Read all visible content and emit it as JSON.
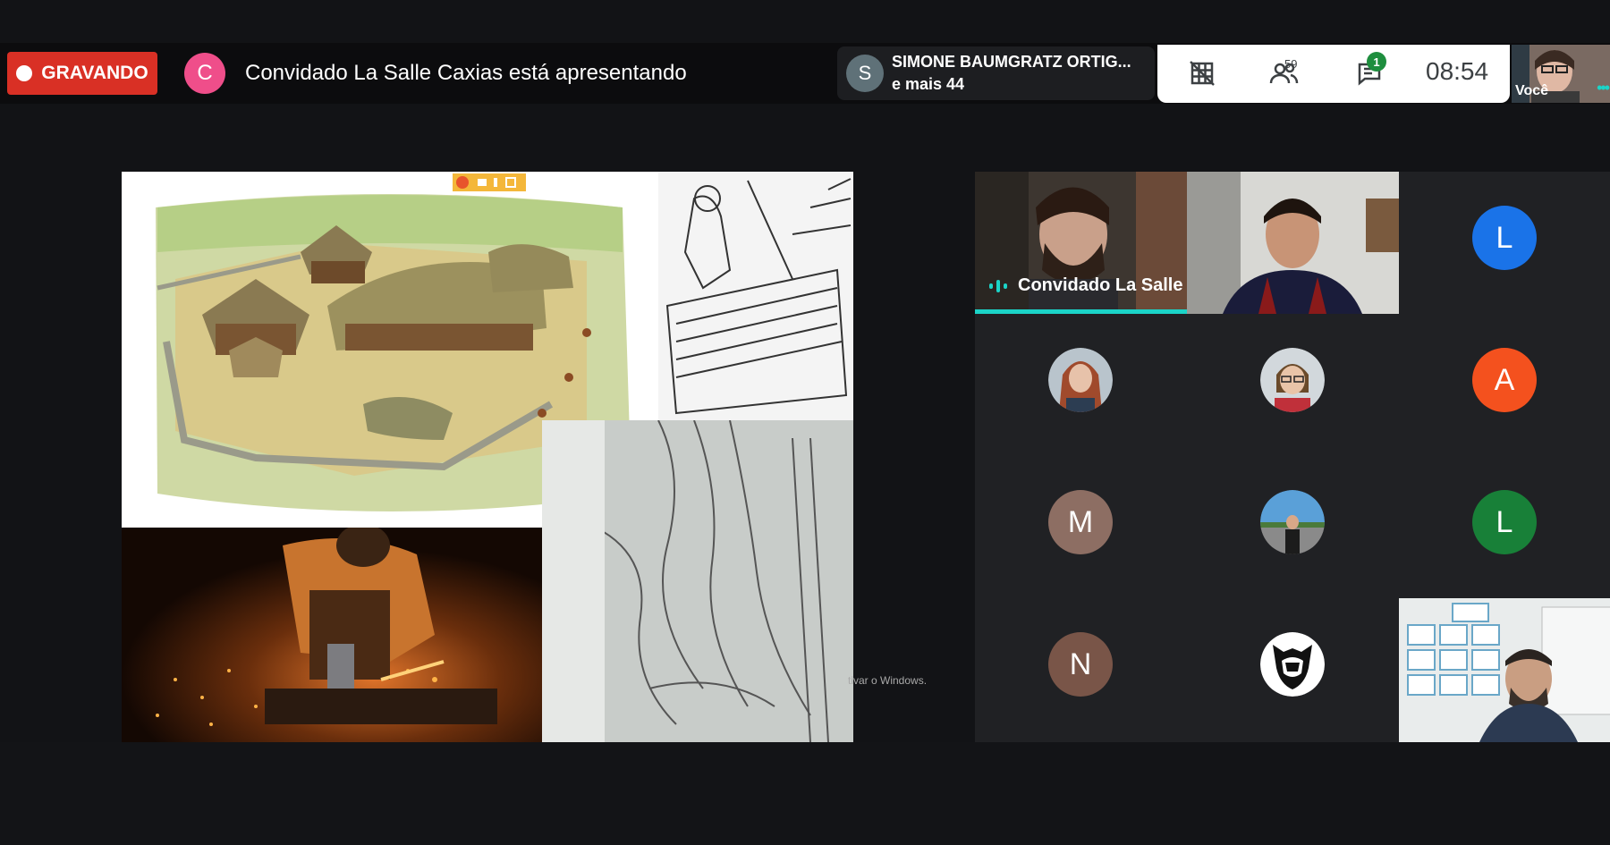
{
  "recording": {
    "label": "GRAVANDO",
    "color": "#d93025"
  },
  "presenter": {
    "initial": "C",
    "text": "Convidado La Salle Caxias está apresentando",
    "avatar_color": "#ef4e8a"
  },
  "people_chip": {
    "initial": "S",
    "name": "SIMONE BAUMGRATZ ORTIG...",
    "more": "e mais 44"
  },
  "toolbar": {
    "participants_count": "59",
    "chat_count": "1",
    "clock": "08:54",
    "self_label": "Você"
  },
  "slide": {
    "watermark": "tivar o Windows."
  },
  "speaker": {
    "label": "Convidado La Salle ...",
    "accent": "#1bd4c8"
  },
  "tiles": [
    {
      "type": "video",
      "name": "speaker-video"
    },
    {
      "type": "video",
      "name": "student-video"
    },
    {
      "type": "letter",
      "initial": "L",
      "color": "#1a73e8"
    },
    {
      "type": "photo",
      "name": "participant-photo-1"
    },
    {
      "type": "photo",
      "name": "participant-photo-2"
    },
    {
      "type": "letter",
      "initial": "A",
      "color": "#f4511e"
    },
    {
      "type": "letter",
      "initial": "M",
      "color": "#8d6e63"
    },
    {
      "type": "photo",
      "name": "participant-photo-3"
    },
    {
      "type": "letter",
      "initial": "L",
      "color": "#188038"
    },
    {
      "type": "letter",
      "initial": "N",
      "color": "#795548"
    },
    {
      "type": "logo",
      "name": "g2-logo"
    },
    {
      "type": "video",
      "name": "teacher-video"
    }
  ]
}
